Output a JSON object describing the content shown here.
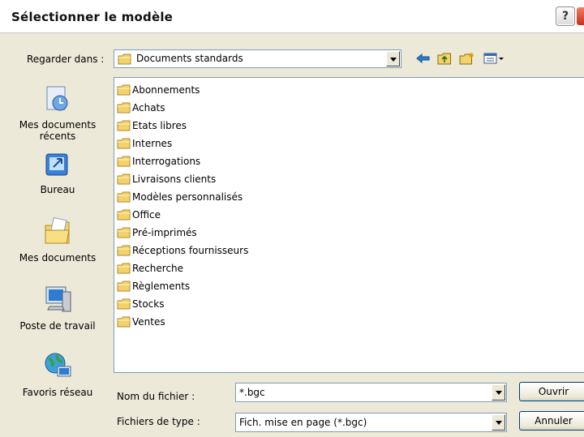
{
  "window": {
    "title": "Sélectionner le modèle",
    "help_label": "?"
  },
  "lookin": {
    "label": "Regarder dans :",
    "value": "Documents standards"
  },
  "toolbar": {
    "icons": [
      "back-arrow-icon",
      "up-folder-icon",
      "new-folder-icon",
      "view-menu-icon"
    ]
  },
  "places": [
    {
      "label": "Mes documents récents",
      "icon": "recent-documents-icon"
    },
    {
      "label": "Bureau",
      "icon": "desktop-icon"
    },
    {
      "label": "Mes documents",
      "icon": "my-documents-icon"
    },
    {
      "label": "Poste de travail",
      "icon": "my-computer-icon"
    },
    {
      "label": "Favoris réseau",
      "icon": "network-places-icon"
    }
  ],
  "folders": [
    "Abonnements",
    "Achats",
    "Etats libres",
    "Internes",
    "Interrogations",
    "Livraisons clients",
    "Modèles personnalisés",
    "Office",
    "Pré-imprimés",
    "Réceptions fournisseurs",
    "Recherche",
    "Règlements",
    "Stocks",
    "Ventes"
  ],
  "filename": {
    "label": "Nom du fichier :",
    "value": "*.bgc"
  },
  "filetype": {
    "label": "Fichiers de type :",
    "value": "Fich. mise en page (*.bgc)"
  },
  "buttons": {
    "open": "Ouvrir",
    "cancel": "Annuler"
  },
  "colors": {
    "folder": "#f2d36b",
    "folder_edge": "#b08a2a",
    "list_border": "#7f9db9",
    "dialog_bg": "#ece9d8"
  }
}
